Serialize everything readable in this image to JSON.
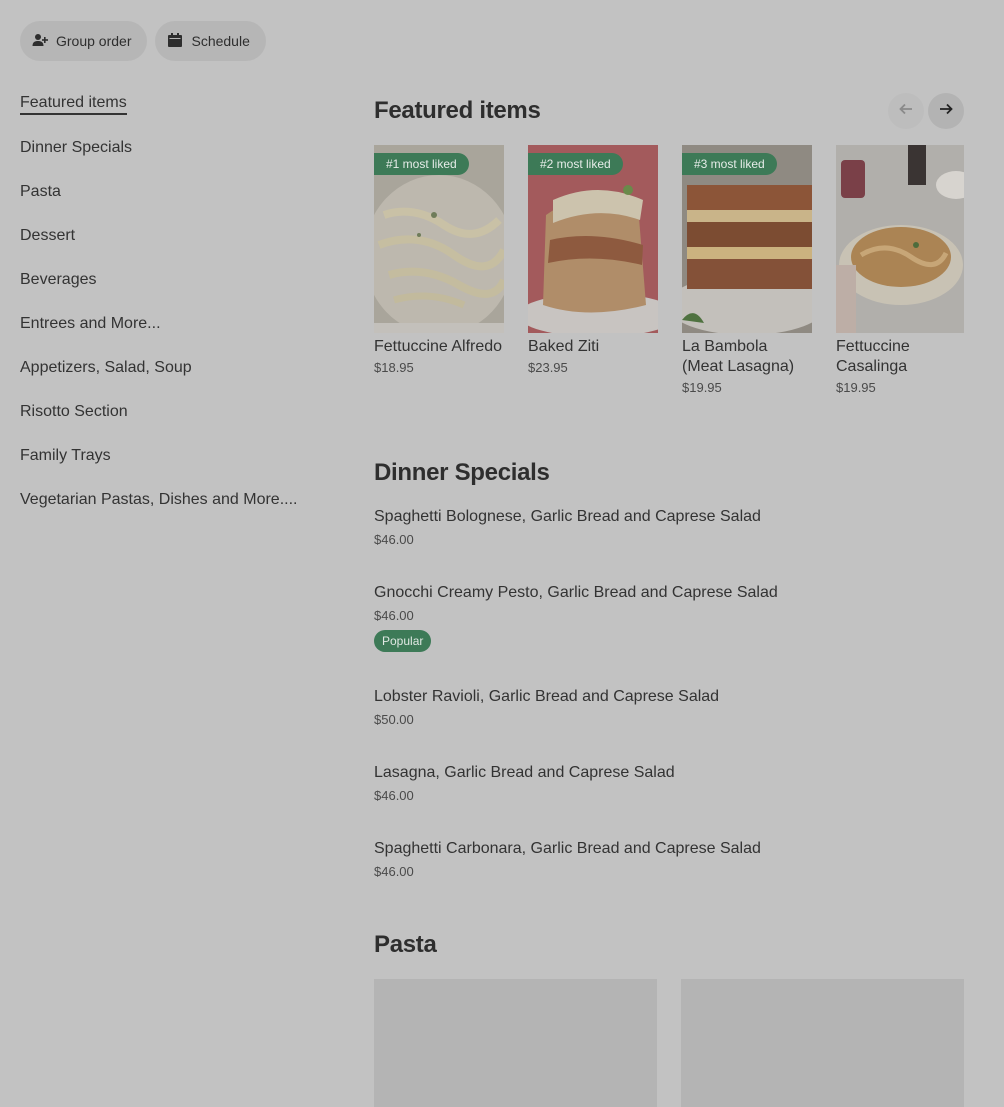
{
  "top_actions": {
    "group_order": "Group order",
    "schedule": "Schedule"
  },
  "sidebar": {
    "items": [
      {
        "label": "Featured items"
      },
      {
        "label": "Dinner Specials"
      },
      {
        "label": "Pasta"
      },
      {
        "label": "Dessert"
      },
      {
        "label": "Beverages"
      },
      {
        "label": "Entrees and More..."
      },
      {
        "label": "Appetizers, Salad, Soup"
      },
      {
        "label": "Risotto Section"
      },
      {
        "label": "Family Trays"
      },
      {
        "label": "Vegetarian Pastas, Dishes and More...."
      }
    ]
  },
  "featured": {
    "title": "Featured items",
    "items": [
      {
        "badge": "#1 most liked",
        "name": "Fettuccine Alfredo",
        "price": "$18.95"
      },
      {
        "badge": "#2 most liked",
        "name": "Baked Ziti",
        "price": "$23.95"
      },
      {
        "badge": "#3 most liked",
        "name": "La Bambola (Meat Lasagna)",
        "price": "$19.95"
      },
      {
        "badge": "",
        "name": "Fettuccine Casalinga",
        "price": "$19.95"
      }
    ]
  },
  "dinner_specials": {
    "title": "Dinner Specials",
    "items": [
      {
        "name": "Spaghetti Bolognese, Garlic Bread and Caprese Salad",
        "price": "$46.00"
      },
      {
        "name": "Gnocchi Creamy Pesto, Garlic Bread and Caprese Salad",
        "price": "$46.00",
        "tag": "Popular"
      },
      {
        "name": "Lobster Ravioli, Garlic Bread and Caprese Salad",
        "price": "$50.00"
      },
      {
        "name": "Lasagna, Garlic Bread and Caprese Salad",
        "price": "$46.00"
      },
      {
        "name": "Spaghetti Carbonara, Garlic Bread and Caprese Salad",
        "price": "$46.00"
      }
    ]
  },
  "pasta": {
    "title": "Pasta"
  },
  "colors": {
    "overlay_bg": "#c2c2c2",
    "badge_green": "#3d7a57"
  },
  "icons": [
    "add-person-icon",
    "calendar-icon",
    "arrow-left-icon",
    "arrow-right-icon"
  ]
}
